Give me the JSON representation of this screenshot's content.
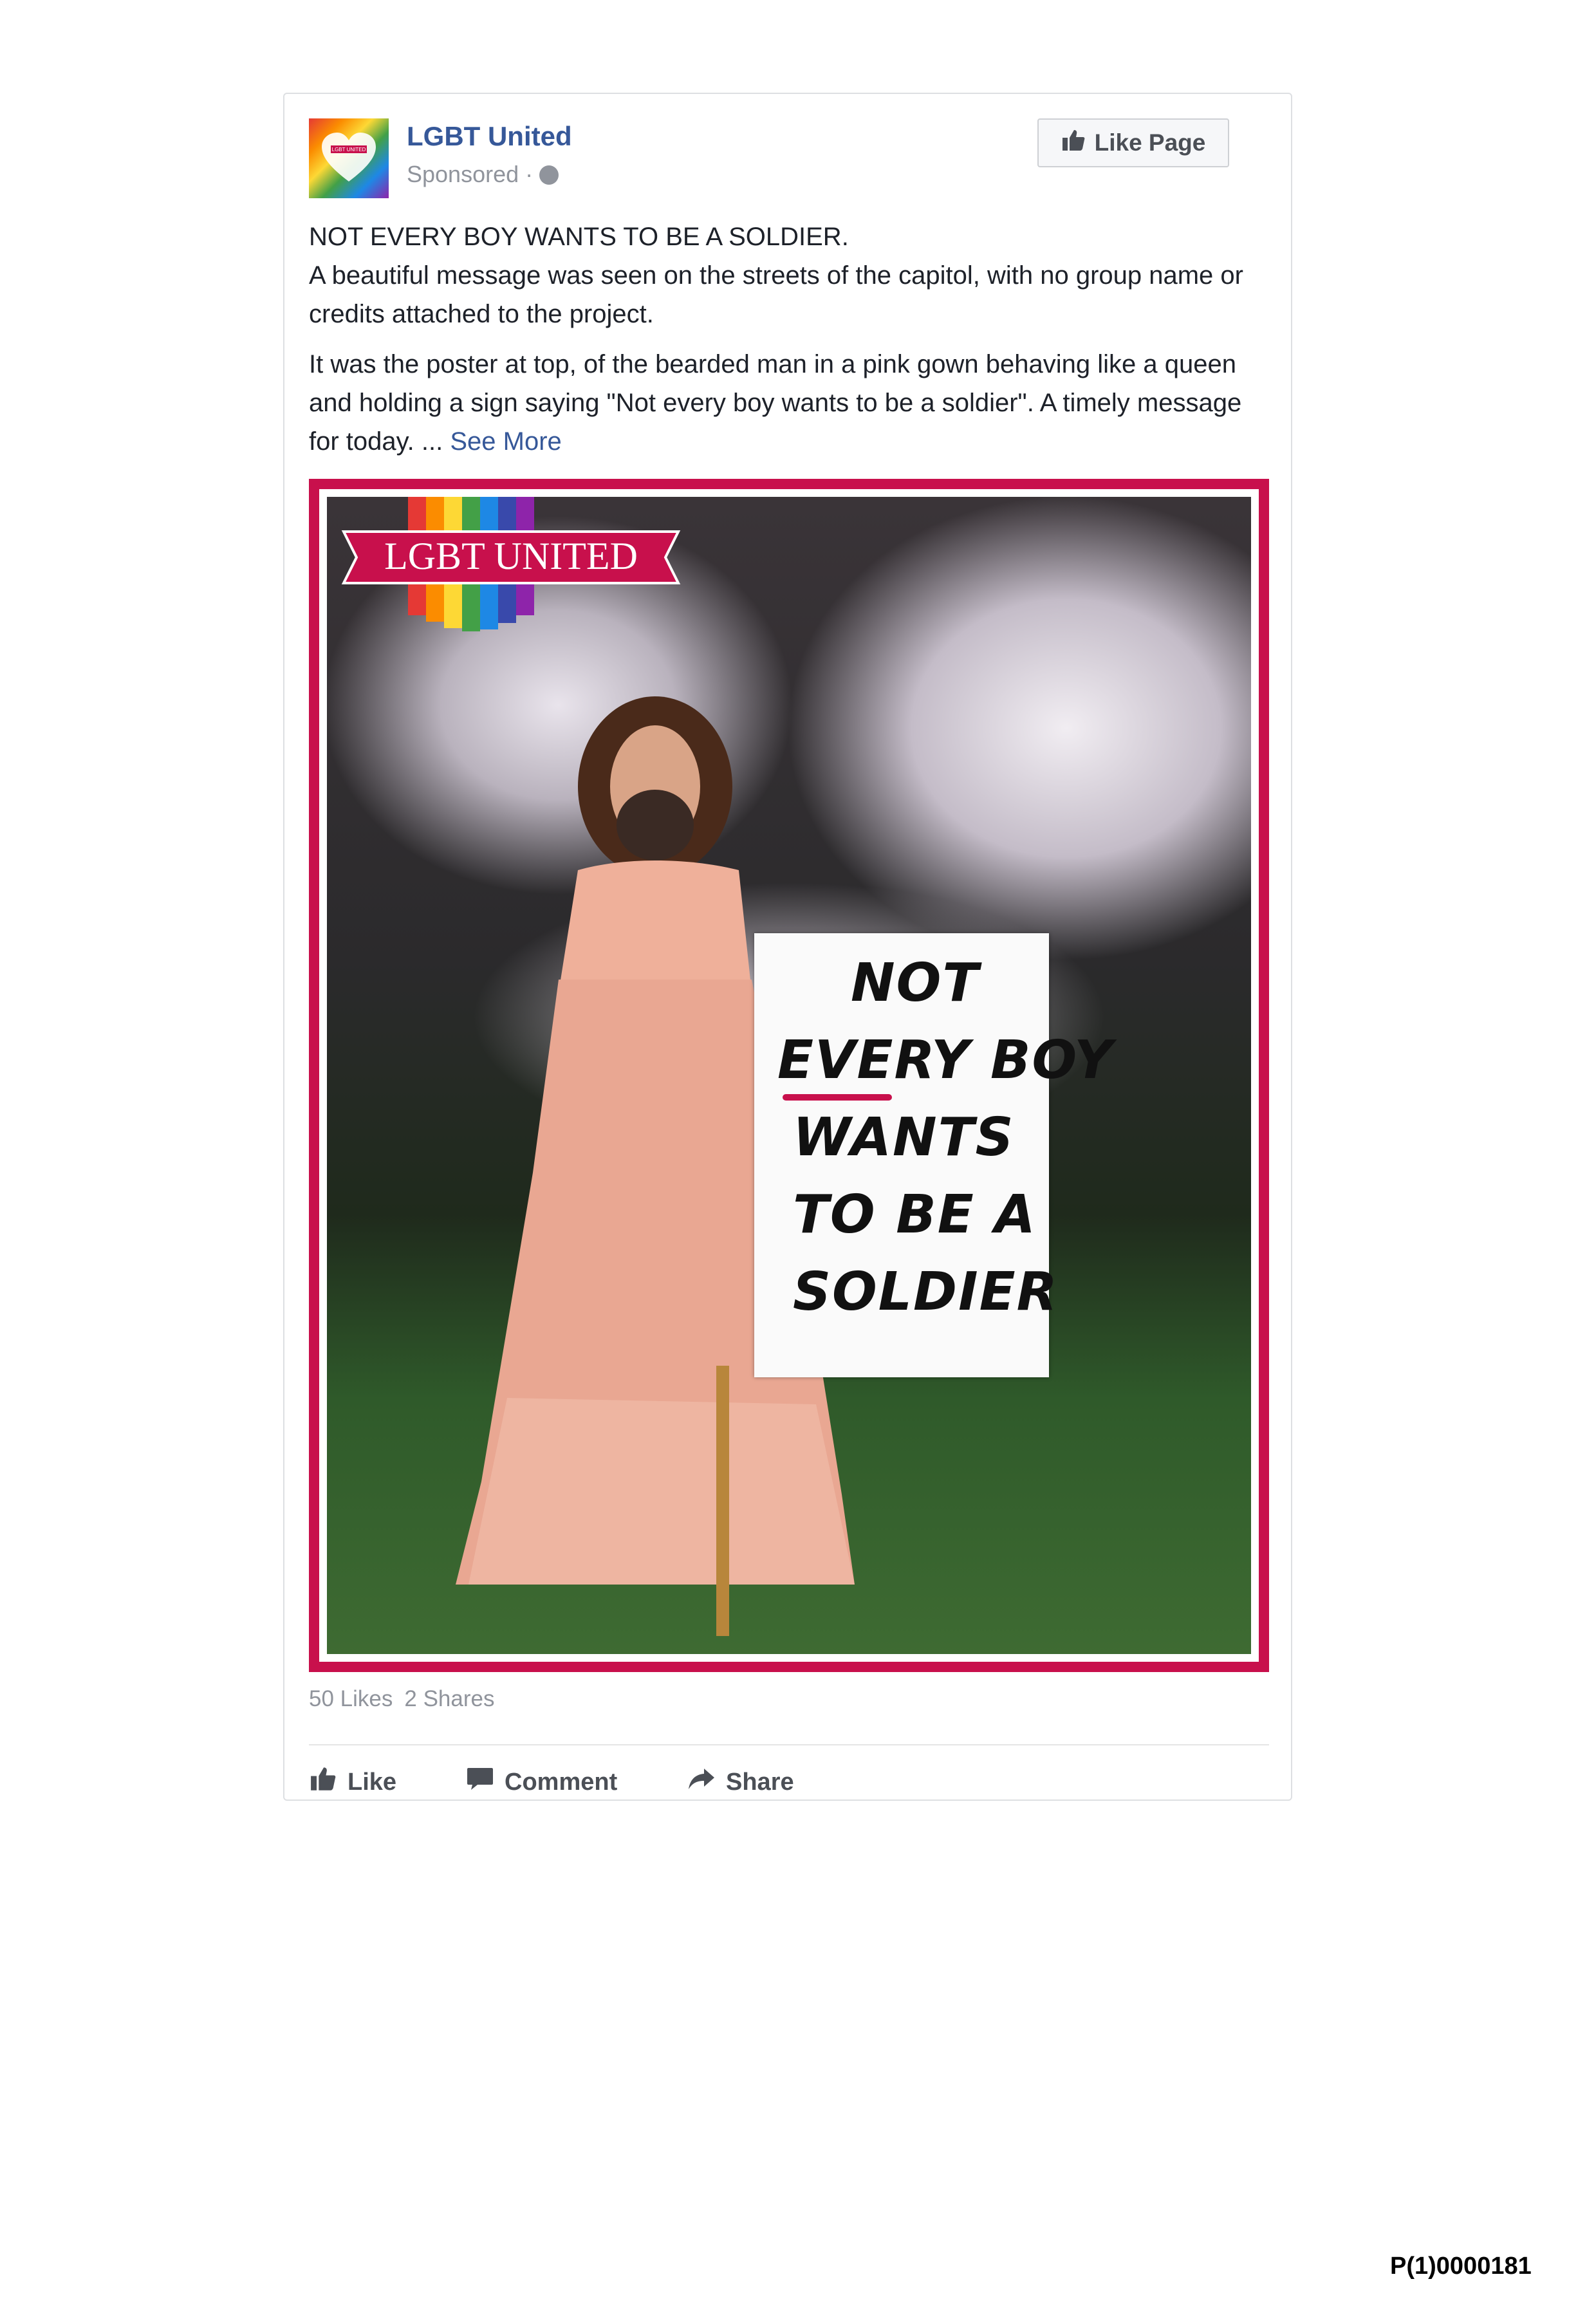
{
  "post": {
    "page_name": "LGBT United",
    "sponsored_label": "Sponsored · ",
    "like_page_label": "Like Page",
    "text": {
      "line1": "NOT EVERY BOY WANTS TO BE A SOLDIER.",
      "line2": "A beautiful message was seen on the streets of the capitol, with no group name or credits attached to the project.",
      "paragraph2": "It was the poster at top, of the bearded man in a pink gown behaving like a queen and holding a sign saying \"Not every boy wants to be a soldier\". A timely message for today. ... ",
      "see_more": "See More"
    },
    "poster": {
      "logo_text": "LGBT UNITED",
      "avatar_text": "LGBT UNITED",
      "sign_lines": [
        "NOT",
        "EVERY BOY",
        "WANTS",
        "TO BE A",
        "SOLDIER"
      ]
    },
    "stats": {
      "likes": "50 Likes",
      "shares": "2 Shares"
    },
    "actions": {
      "like": "Like",
      "comment": "Comment",
      "share": "Share"
    }
  },
  "document_id": "P(1)0000181",
  "colors": {
    "brand_blue": "#365899",
    "poster_border": "#c8104c",
    "meta_gray": "#90949c"
  }
}
